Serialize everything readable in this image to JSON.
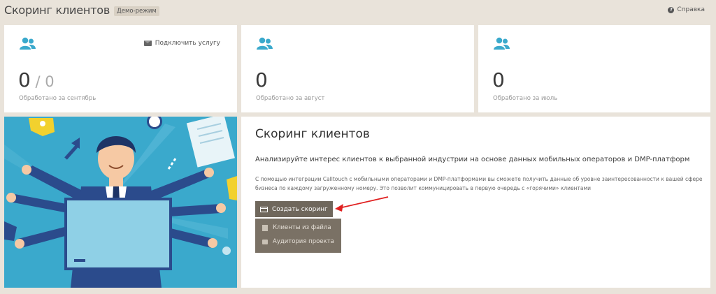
{
  "header": {
    "title": "Скоринг клиентов",
    "demo_badge": "Демо-режим",
    "help_label": "Справка"
  },
  "stats": [
    {
      "value": "0",
      "total": "0",
      "caption": "Обработано за сентябрь",
      "connect_label": "Подключить услугу"
    },
    {
      "value": "0",
      "caption": "Обработано за август"
    },
    {
      "value": "0",
      "caption": "Обработано за июль"
    }
  ],
  "description": {
    "title": "Скоринг клиентов",
    "lead": "Анализируйте интерес клиентов к выбранной индустрии на основе данных мобильных операторов и DMP-платформ",
    "details": "С помощью интеграции Calltouch с мобильными операторами и DMP-платформами вы сможете получить данные об уровне заинтересованности к вашей сфере бизнеса по каждому загруженному номеру. Это позволит коммуницировать в первую очередь с «горячими» клиентами",
    "create_button": "Создать скоринг",
    "menu": [
      {
        "label": "Клиенты из файла",
        "icon": "file-icon"
      },
      {
        "label": "Аудитория проекта",
        "icon": "audience-icon"
      }
    ]
  },
  "colors": {
    "accent_blue": "#3aa9cc",
    "button_brown": "#6f675c",
    "background": "#e9e3da",
    "annotation_red": "#e02020"
  }
}
